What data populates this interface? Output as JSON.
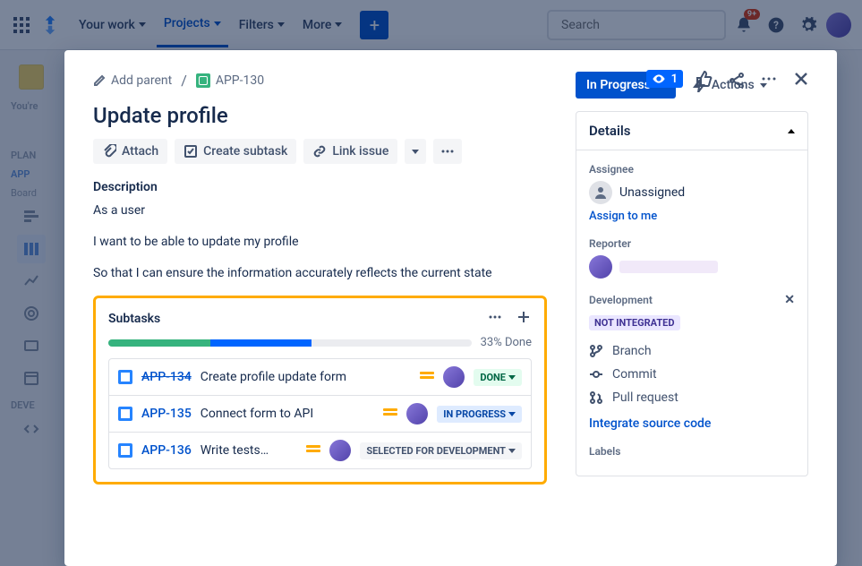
{
  "topnav": {
    "items": [
      "Your work",
      "Projects",
      "Filters",
      "More"
    ],
    "active_index": 1,
    "search_placeholder": "Search",
    "notification_count": "9+"
  },
  "sidebar": {
    "you_are": "You're",
    "planning": "PLAN",
    "app_label": "APP",
    "board_label": "Board",
    "devel": "DEVE"
  },
  "breadcrumb": {
    "add_parent": "Add parent",
    "issue_key": "APP-130"
  },
  "watch_count": "1",
  "issue": {
    "title": "Update profile",
    "attach": "Attach",
    "create_subtask": "Create subtask",
    "link_issue": "Link issue",
    "description_label": "Description",
    "description_lines": [
      "As a user",
      "I want to be able to update my profile",
      "So that I can ensure the information accurately reflects the current state"
    ]
  },
  "subtasks": {
    "title": "Subtasks",
    "progress_pct": 33,
    "progress_label": "33% Done",
    "items": [
      {
        "key": "APP-134",
        "summary": "Create profile update form",
        "status": "DONE",
        "status_class": "status-done",
        "done": true
      },
      {
        "key": "APP-135",
        "summary": "Connect form to API",
        "status": "IN PROGRESS",
        "status_class": "status-prog",
        "done": false
      },
      {
        "key": "APP-136",
        "summary": "Write tests…",
        "status": "SELECTED FOR DEVELOPMENT",
        "status_class": "status-todo",
        "done": false
      }
    ]
  },
  "right": {
    "status": "In Progress",
    "actions": "Actions",
    "details": "Details",
    "assignee_label": "Assignee",
    "assignee_value": "Unassigned",
    "assign_to_me": "Assign to me",
    "reporter_label": "Reporter",
    "development_label": "Development",
    "not_integrated": "NOT INTEGRATED",
    "branch": "Branch",
    "commit": "Commit",
    "pull_request": "Pull request",
    "integrate": "Integrate source code",
    "labels_label": "Labels"
  }
}
